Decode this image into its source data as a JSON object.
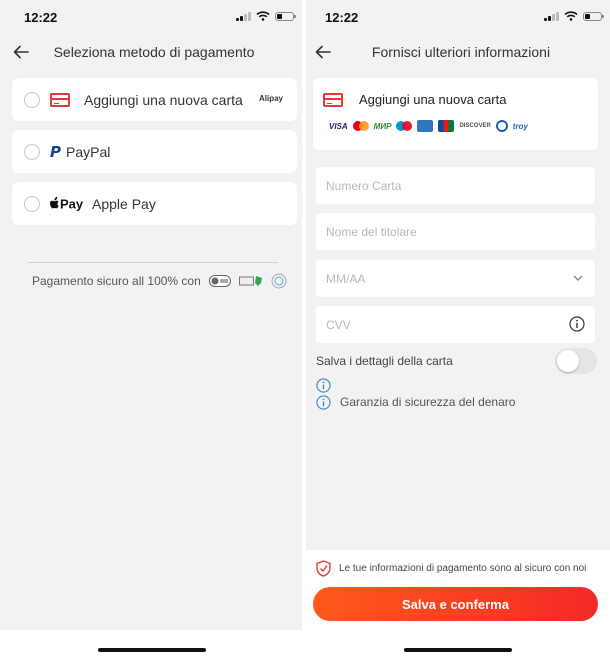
{
  "colors": {
    "accent": "#f52828",
    "background": "#f2f2f2",
    "info_blue": "#3a86c8"
  },
  "left_screen": {
    "status": {
      "time": "12:22"
    },
    "nav": {
      "title": "Seleziona metodo di pagamento",
      "back_icon": "arrow-left-icon"
    },
    "methods": [
      {
        "label": "Aggiungi una nuova carta",
        "icon": "credit-card-icon",
        "badge": "Alipay"
      },
      {
        "label": "PayPal",
        "icon": "paypal-icon"
      },
      {
        "label": "Apple Pay",
        "icon": "apple-pay-icon",
        "icon_text": "Pay"
      }
    ],
    "secure": {
      "text": "Pagamento sicuro all 100% con",
      "badges": [
        "ssl-icon",
        "pci-icon",
        "security-seal-icon"
      ]
    }
  },
  "right_screen": {
    "status": {
      "time": "12:22"
    },
    "nav": {
      "title": "Fornisci ulteriori informazioni",
      "back_icon": "arrow-left-icon"
    },
    "card_section": {
      "label": "Aggiungi una nuova carta",
      "brands": {
        "visa": "VISA",
        "mir": "МИР",
        "troy": "troy",
        "discover": "DISCOVER"
      }
    },
    "fields": {
      "card_number": "Numero Carta",
      "holder": "Nome del titolare",
      "expiry": "MM/AA",
      "cvv": "CVV"
    },
    "save_card": {
      "label": "Salva i dettagli della carta",
      "checked": false
    },
    "guarantee": "Garanzia di sicurezza del denaro",
    "footer": {
      "secure_text": "Le tue informazioni di pagamento sono al sicuro con noi",
      "button": "Salva e conferma"
    }
  }
}
